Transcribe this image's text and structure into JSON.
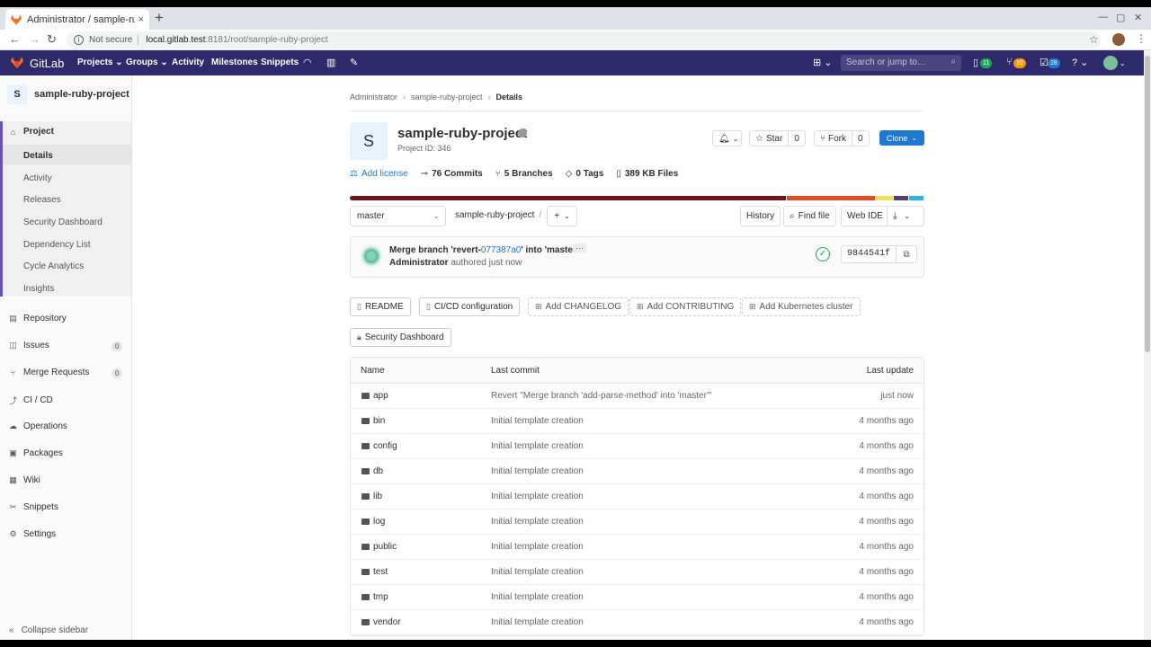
{
  "browser": {
    "tab_title": "Administrator / sample-ruby-project",
    "tab_close": "×",
    "new_tab": "+",
    "not_secure": "Not secure",
    "url_host": "local.gitlab.test",
    "url_path": ":8181/root/sample-ruby-project"
  },
  "header": {
    "brand": "GitLab",
    "nav": [
      "Projects",
      "Groups",
      "Activity",
      "Milestones",
      "Snippets"
    ],
    "search_placeholder": "Search or jump to…",
    "badges": {
      "issues": "11",
      "merge_requests": "10",
      "todos": "28"
    }
  },
  "sidebar": {
    "project_initial": "S",
    "project_name": "sample-ruby-project",
    "section": "Project",
    "subitems": [
      "Details",
      "Activity",
      "Releases",
      "Security Dashboard",
      "Dependency List",
      "Cycle Analytics",
      "Insights"
    ],
    "items": [
      {
        "label": "Repository",
        "icon": "book-icon"
      },
      {
        "label": "Issues",
        "icon": "issues-icon",
        "count": "0"
      },
      {
        "label": "Merge Requests",
        "icon": "merge-request-icon",
        "count": "0"
      },
      {
        "label": "CI / CD",
        "icon": "rocket-icon"
      },
      {
        "label": "Operations",
        "icon": "cloud-icon"
      },
      {
        "label": "Packages",
        "icon": "package-icon"
      },
      {
        "label": "Wiki",
        "icon": "wiki-icon"
      },
      {
        "label": "Snippets",
        "icon": "scissors-icon"
      },
      {
        "label": "Settings",
        "icon": "gear-icon"
      }
    ],
    "collapse_label": "Collapse sidebar"
  },
  "breadcrumb": [
    "Administrator",
    "sample-ruby-project",
    "Details"
  ],
  "project": {
    "initial": "S",
    "name": "sample-ruby-project",
    "id_label": "Project ID: 346",
    "star_label": "Star",
    "star_count": "0",
    "fork_label": "Fork",
    "fork_count": "0",
    "clone_label": "Clone"
  },
  "stats": {
    "add_license": "Add license",
    "commits": "76 Commits",
    "branches": "5 Branches",
    "tags": "0 Tags",
    "files": "389 KB Files"
  },
  "languages": [
    {
      "color": "#701516",
      "share": 0.765
    },
    {
      "color": "#e34c26",
      "share": 0.155
    },
    {
      "color": "#f1e05a",
      "share": 0.03
    },
    {
      "color": "#563d7c",
      "share": 0.025
    },
    {
      "color": "#24b6e7",
      "share": 0.025
    }
  ],
  "tree": {
    "branch": "master",
    "path": "sample-ruby-project",
    "path_sep": "/",
    "history": "History",
    "find_file": "Find file",
    "web_ide": "Web IDE"
  },
  "commit": {
    "title_pre": "Merge branch 'revert-",
    "title_sha": "077387a0",
    "title_post": "' into 'master'",
    "more": "···",
    "author": "Administrator",
    "meta": "authored just now",
    "sha": "9844541f"
  },
  "quick_links": [
    "README",
    "CI/CD configuration",
    "Add CHANGELOG",
    "Add CONTRIBUTING",
    "Add Kubernetes cluster",
    "Security Dashboard"
  ],
  "files_table": {
    "headers": {
      "name": "Name",
      "last_commit": "Last commit",
      "last_update": "Last update"
    },
    "rows": [
      {
        "name": "app",
        "commit": "Revert \"Merge branch 'add-parse-method' into 'master'\"",
        "updated": "just now"
      },
      {
        "name": "bin",
        "commit": "Initial template creation",
        "updated": "4 months ago"
      },
      {
        "name": "config",
        "commit": "Initial template creation",
        "updated": "4 months ago"
      },
      {
        "name": "db",
        "commit": "Initial template creation",
        "updated": "4 months ago"
      },
      {
        "name": "lib",
        "commit": "Initial template creation",
        "updated": "4 months ago"
      },
      {
        "name": "log",
        "commit": "Initial template creation",
        "updated": "4 months ago"
      },
      {
        "name": "public",
        "commit": "Initial template creation",
        "updated": "4 months ago"
      },
      {
        "name": "test",
        "commit": "Initial template creation",
        "updated": "4 months ago"
      },
      {
        "name": "tmp",
        "commit": "Initial template creation",
        "updated": "4 months ago"
      },
      {
        "name": "vendor",
        "commit": "Initial template creation",
        "updated": "4 months ago"
      }
    ]
  },
  "colors": {
    "header_bg": "#2f2a6b",
    "link": "#1f78d1",
    "success": "#1aaa55",
    "sidebar_accent": "#6b4fbb"
  }
}
